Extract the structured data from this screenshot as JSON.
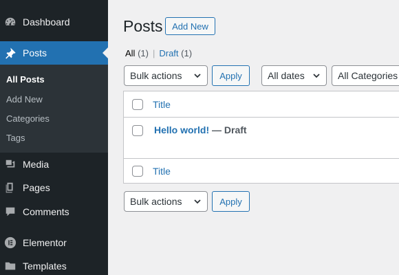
{
  "sidebar": {
    "dashboard": "Dashboard",
    "posts": "Posts",
    "submenu": [
      "All Posts",
      "Add New",
      "Categories",
      "Tags"
    ],
    "media": "Media",
    "pages": "Pages",
    "comments": "Comments",
    "elementor": "Elementor",
    "templates": "Templates"
  },
  "header": {
    "title": "Posts",
    "add_new": "Add New"
  },
  "views": {
    "all_label": "All",
    "all_count": "(1)",
    "separator": "|",
    "draft_label": "Draft",
    "draft_count": "(1)"
  },
  "filters": {
    "bulk_actions": "Bulk actions",
    "apply": "Apply",
    "dates": "All dates",
    "categories": "All Categories"
  },
  "table": {
    "column_title": "Title",
    "rows": [
      {
        "title": "Hello world!",
        "state": " — Draft"
      }
    ]
  },
  "colors": {
    "sidebar_bg": "#1d2327",
    "accent": "#2271b1",
    "content_bg": "#f0f0f1"
  }
}
